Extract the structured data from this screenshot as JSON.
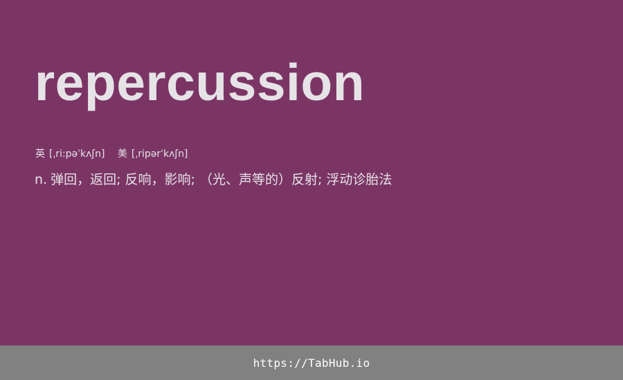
{
  "entry": {
    "word": "repercussion",
    "phonetics": {
      "uk_label": "英",
      "uk": "[ˌri:pəˈkʌʃn]",
      "us_label": "美",
      "us": "[ˌripərˈkʌʃn]"
    },
    "definition": {
      "part_of_speech": "n.",
      "text": "弹回，返回; 反响，影响; （光、声等的）反射; 浮动诊胎法"
    }
  },
  "footer": {
    "link_text": "https://TabHub.io"
  },
  "colors": {
    "background": "#7b3565",
    "text": "#e6e3e7",
    "footer_background": "#818181",
    "footer_text": "#ffffff"
  }
}
